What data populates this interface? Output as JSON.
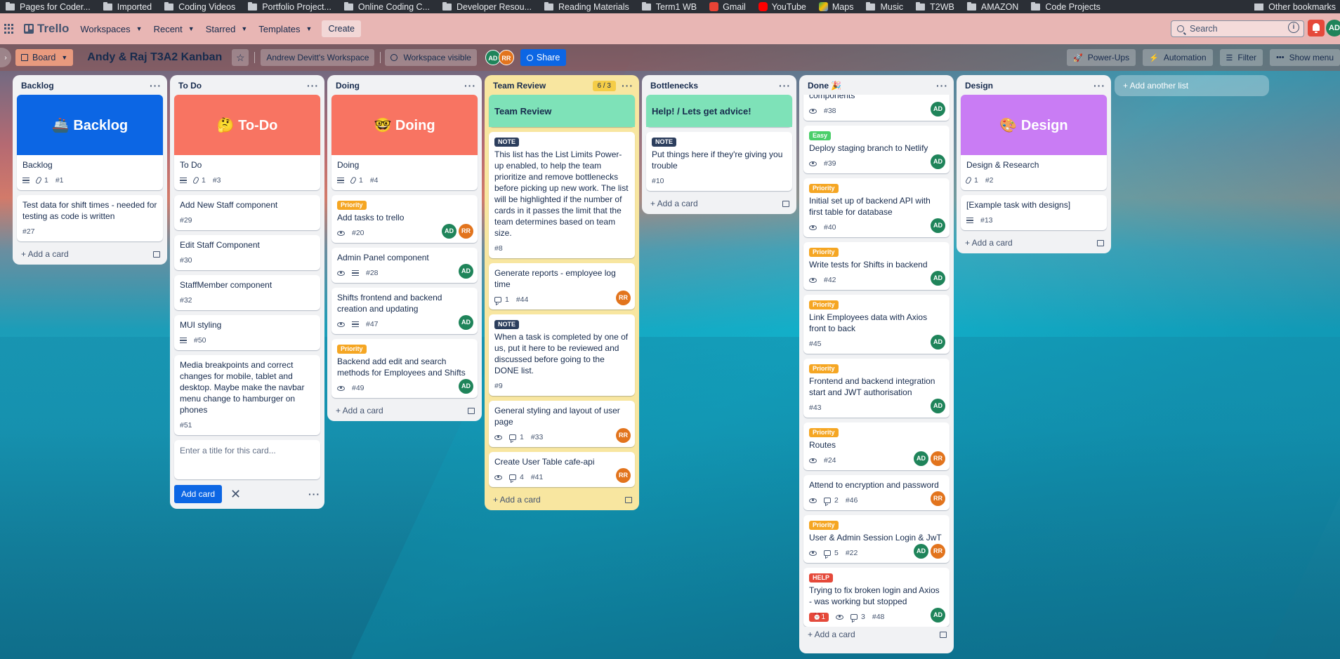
{
  "bookmarks": [
    {
      "label": "Pages for Coder..."
    },
    {
      "label": "Imported"
    },
    {
      "label": "Coding Videos"
    },
    {
      "label": "Portfolio Project..."
    },
    {
      "label": "Online Coding C..."
    },
    {
      "label": "Developer Resou..."
    },
    {
      "label": "Reading Materials"
    },
    {
      "label": "Term1 WB"
    },
    {
      "label": "Gmail"
    },
    {
      "label": "YouTube"
    },
    {
      "label": "Maps"
    },
    {
      "label": "Music"
    },
    {
      "label": "T2WB"
    },
    {
      "label": "AMAZON"
    },
    {
      "label": "Code Projects"
    }
  ],
  "bookmarks_other": "Other bookmarks",
  "nav": {
    "brand": "Trello",
    "workspaces": "Workspaces",
    "recent": "Recent",
    "starred": "Starred",
    "templates": "Templates",
    "create": "Create",
    "search_placeholder": "Search",
    "user_initials": "AD"
  },
  "board": {
    "view": "Board",
    "title": "Andy & Raj T3A2 Kanban",
    "workspace": "Andrew Devitt's Workspace",
    "visibility": "Workspace visible",
    "members": [
      "AD",
      "RR"
    ],
    "share": "Share",
    "powerups": "Power-Ups",
    "automation": "Automation",
    "filter": "Filter",
    "show_menu": "Show menu",
    "add_list": "+ Add another list",
    "add_card": "+ Add a card"
  },
  "lists": {
    "backlog": {
      "title": "Backlog",
      "cover": "🚢 Backlog",
      "cards": [
        {
          "title": "Backlog",
          "attach": "1",
          "num": "#1"
        },
        {
          "title": "Test data for shift times - needed for testing as code is written",
          "num": "#27"
        }
      ]
    },
    "todo": {
      "title": "To Do",
      "cover": "🤔 To-Do",
      "cards": [
        {
          "title": "To Do",
          "attach": "1",
          "num": "#3"
        },
        {
          "title": "Add New Staff component",
          "num": "#29"
        },
        {
          "title": "Edit Staff Component",
          "num": "#30"
        },
        {
          "title": "StaffMember component",
          "num": "#32"
        },
        {
          "title": "MUI styling",
          "num": "#50"
        },
        {
          "title": "Media breakpoints and correct changes for mobile, tablet and desktop. Maybe make the navbar menu change to hamburger on phones",
          "num": "#51"
        }
      ],
      "compose_placeholder": "Enter a title for this card...",
      "add_button": "Add card"
    },
    "doing": {
      "title": "Doing",
      "cover": "🤓 Doing",
      "cards": [
        {
          "title": "Doing",
          "attach": "1",
          "num": "#4"
        },
        {
          "label": "Priority",
          "title": "Add tasks to trello",
          "num": "#20"
        },
        {
          "title": "Admin Panel component",
          "num": "#28"
        },
        {
          "title": "Shifts frontend and backend creation and updating",
          "num": "#47"
        },
        {
          "label": "Priority",
          "title": "Backend add edit and search methods for Employees and Shifts",
          "num": "#49"
        }
      ]
    },
    "review": {
      "title": "Team Review",
      "limit": "6 / 3",
      "cover": "Team Review",
      "cards": [
        {
          "label": "NOTE",
          "title": "This list has the List Limits Power-up enabled, to help the team prioritize and remove bottlenecks before picking up new work. The list will be highlighted if the number of cards in it passes the limit that the team determines based on team size.",
          "num": "#8"
        },
        {
          "title": "Generate reports - employee log time",
          "comments": "1",
          "num": "#44"
        },
        {
          "label": "NOTE",
          "title": "When a task is completed by one of us, put it here to be reviewed and discussed before going to the DONE list.",
          "num": "#9"
        },
        {
          "title": "General styling and layout of user page",
          "comments": "1",
          "num": "#33"
        },
        {
          "title": "Create User Table cafe-api",
          "comments": "4",
          "num": "#41"
        }
      ]
    },
    "bottlenecks": {
      "title": "Bottlenecks",
      "cover": "Help! / Lets get advice!",
      "cards": [
        {
          "label": "NOTE",
          "title": "Put things here if they're giving you trouble",
          "num": "#10"
        }
      ]
    },
    "done": {
      "title": "Done 🎉",
      "cards": [
        {
          "title": "components",
          "num": "#38"
        },
        {
          "label": "Easy",
          "title": "Deploy staging branch to Netlify",
          "num": "#39"
        },
        {
          "label": "Priority",
          "title": "Initial set up of backend API with first table for database",
          "num": "#40"
        },
        {
          "label": "Priority",
          "title": "Write tests for Shifts in backend",
          "num": "#42"
        },
        {
          "label": "Priority",
          "title": "Link Employees data with Axios front to back",
          "num": "#45"
        },
        {
          "label": "Priority",
          "title": "Frontend and backend integration start and JWT authorisation",
          "num": "#43"
        },
        {
          "label": "Priority",
          "title": "Routes",
          "num": "#24"
        },
        {
          "title": "Attend to encryption and password",
          "comments": "2",
          "num": "#46"
        },
        {
          "label": "Priority",
          "title": "User & Admin Session Login & JwT",
          "comments": "5",
          "num": "#22"
        },
        {
          "label": "HELP",
          "title": "Trying to fix broken login and Axios - was working but stopped",
          "alarm": "1",
          "comments": "3",
          "num": "#48"
        }
      ]
    },
    "design": {
      "title": "Design",
      "cover": "🎨 Design",
      "cards": [
        {
          "title": "Design & Research",
          "attach": "1",
          "num": "#2"
        },
        {
          "title": "[Example task with designs]",
          "num": "#13"
        }
      ]
    }
  },
  "colors": {
    "backlog_cover": "#0c66e4",
    "todo_cover": "#f87462",
    "doing_cover": "#f87462",
    "review_cover": "#7ee2b8",
    "bottleneck_cover": "#7ee2b8",
    "design_cover": "#c97cf4"
  }
}
